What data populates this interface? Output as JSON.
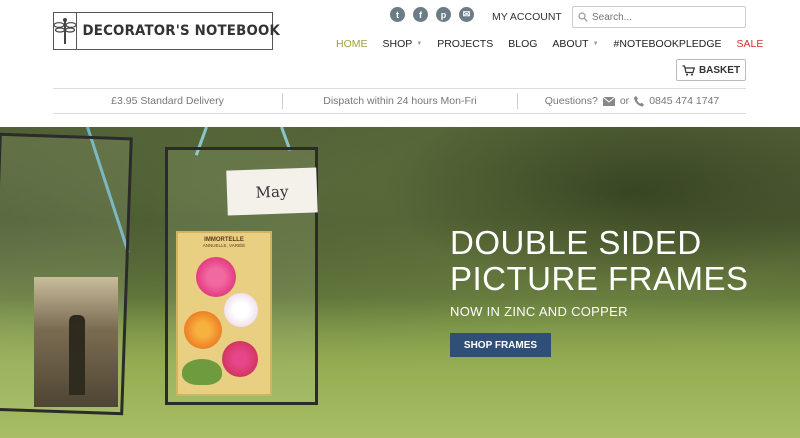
{
  "logo": {
    "text": "DECORATOR'S NOTEBOOK",
    "icon": "dragonfly-icon"
  },
  "social": [
    {
      "icon": "twitter-icon",
      "glyph": "t"
    },
    {
      "icon": "facebook-icon",
      "glyph": "f"
    },
    {
      "icon": "pinterest-icon",
      "glyph": "p"
    },
    {
      "icon": "email-icon",
      "glyph": "✉"
    }
  ],
  "account": {
    "label": "MY ACCOUNT"
  },
  "search": {
    "placeholder": "Search..."
  },
  "nav": {
    "home": "HOME",
    "shop": "SHOP",
    "projects": "PROJECTS",
    "blog": "BLOG",
    "about": "ABOUT",
    "pledge": "#NOTEBOOKPLEDGE",
    "sale": "SALE"
  },
  "basket": {
    "label": "BASKET"
  },
  "info": {
    "delivery": "£3.95 Standard Delivery",
    "dispatch": "Dispatch within 24 hours Mon-Fri",
    "questions": "Questions?",
    "or": "or",
    "phone": "0845 474 1747"
  },
  "hero": {
    "title_line1": "DOUBLE SIDED",
    "title_line2": "PICTURE FRAMES",
    "subtitle": "NOW IN ZINC AND COPPER",
    "cta": "SHOP FRAMES",
    "tag_label": "May",
    "packet_title": "IMMORTELLE",
    "packet_sub": "ANNUELLE, VARIÉE"
  },
  "colors": {
    "accent_home": "#9aa23b",
    "sale": "#d0312d",
    "cta_bg": "#2f4f77",
    "social_bg": "#6b7c86"
  }
}
